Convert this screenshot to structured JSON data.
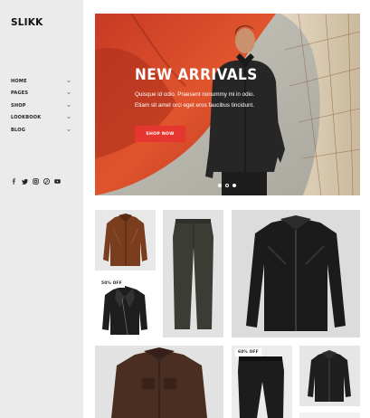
{
  "brand": {
    "logo": "SLIKK"
  },
  "nav": {
    "items": [
      {
        "label": "HOME",
        "icon": "chevron-down-icon"
      },
      {
        "label": "PAGES",
        "icon": "chevron-down-icon"
      },
      {
        "label": "SHOP",
        "icon": "chevron-down-icon"
      },
      {
        "label": "LOOKBOOK",
        "icon": "chevron-down-icon"
      },
      {
        "label": "BLOG",
        "icon": "chevron-down-icon"
      }
    ]
  },
  "social": [
    "facebook-icon",
    "twitter-icon",
    "instagram-icon",
    "pinterest-icon",
    "youtube-icon"
  ],
  "hero": {
    "title": "NEW ARRIVALS",
    "subtitle_line1": "Quisque id odio. Praesent nonummy mi in odio.",
    "subtitle_line2": "Etiam sit amet orci eget eros faucibus tincidunt.",
    "button": "SHOP NOW",
    "slides": 3,
    "active_slide": 1
  },
  "products": {
    "badge_1": "50% OFF",
    "badge_2": "60% OFF"
  },
  "colors": {
    "accent": "#e5372f",
    "sidebar": "#ebebeb"
  }
}
